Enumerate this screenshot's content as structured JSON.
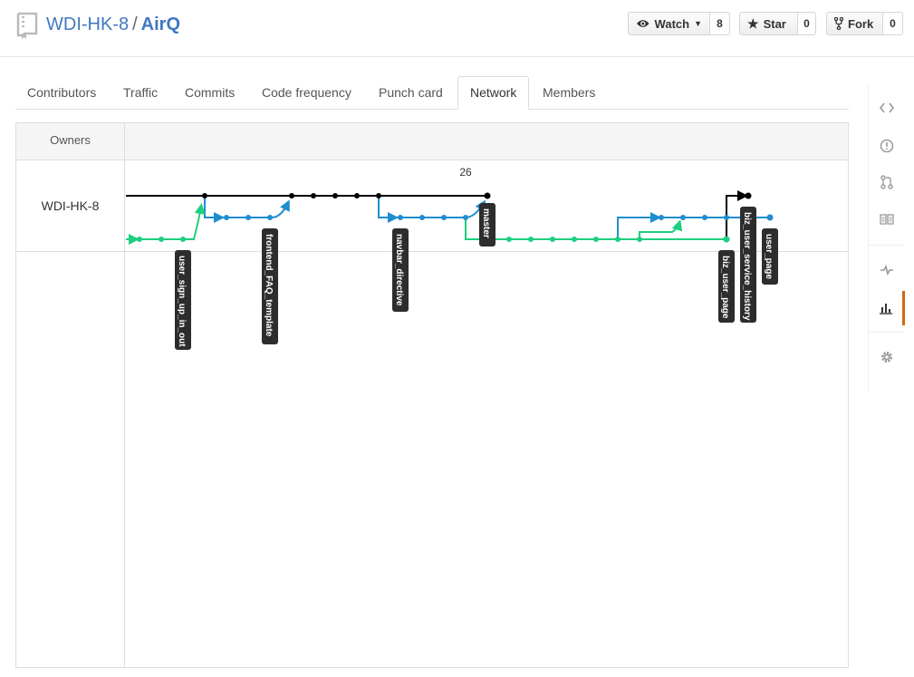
{
  "repo": {
    "owner": "WDI-HK-8",
    "separator": "/",
    "name": "AirQ"
  },
  "actions": {
    "watch_label": "Watch",
    "watch_count": "8",
    "star_label": "Star",
    "star_count": "0",
    "fork_label": "Fork",
    "fork_count": "0"
  },
  "tabs": [
    {
      "label": "Contributors"
    },
    {
      "label": "Traffic"
    },
    {
      "label": "Commits"
    },
    {
      "label": "Code frequency"
    },
    {
      "label": "Punch card"
    },
    {
      "label": "Network",
      "active": true
    },
    {
      "label": "Members"
    }
  ],
  "network": {
    "owners_header": "Owners",
    "owner_name": "WDI-HK-8",
    "date_label": "26",
    "colors": {
      "master": "#000000",
      "blue": "#1f8ecf",
      "green": "#1dcf7e",
      "label_bg": "#2d2d2d"
    },
    "branch_labels": [
      "user_sign_up_in_out",
      "frontend_FAQ_template",
      "navbar_directive",
      "master",
      "biz_user_page",
      "biz_user_service_history",
      "user_page"
    ]
  },
  "sidebar": {
    "icons": [
      "code-icon",
      "issues-icon",
      "pull-request-icon",
      "wiki-icon",
      "pulse-icon",
      "graphs-icon",
      "settings-icon"
    ],
    "active": "graphs-icon"
  }
}
